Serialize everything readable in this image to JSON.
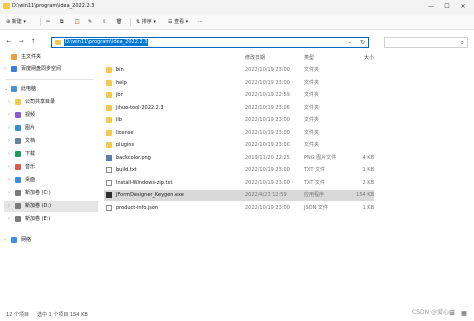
{
  "window": {
    "title": "D:\\win11\\program\\idea_2022.2.3",
    "minimize_glyph": "—",
    "maximize_glyph": "☐",
    "close_glyph": "✕"
  },
  "toolbar": {
    "new_label": "⊕ 新建 ▾",
    "sort_label": "⇅ 排序 ▾",
    "view_label": "☰ 查看 ▾",
    "more_label": "···"
  },
  "nav": {
    "back_glyph": "←",
    "forward_glyph": "→",
    "up_glyph": "↑",
    "address": "D:\\win11\\program\\idea_2022.2.3",
    "chevron_glyph": "⌄",
    "refresh_glyph": "↻",
    "search_glyph": "⌕"
  },
  "sidebar": {
    "items": [
      {
        "label": "主文件夹",
        "icon": "home-icon",
        "color": "#e8a23a"
      },
      {
        "label": "百度网盘同步空间",
        "icon": "cloud-icon",
        "color": "#3b7de0"
      },
      {
        "label": "此电脑",
        "icon": "pc-icon",
        "color": "#4a90d9"
      },
      {
        "label": "公司共享目录",
        "icon": "folder-icon",
        "color": "#f2c94c"
      },
      {
        "label": "视频",
        "icon": "video-icon",
        "color": "#8e5bd6"
      },
      {
        "label": "图片",
        "icon": "pictures-icon",
        "color": "#2f8fd6"
      },
      {
        "label": "文档",
        "icon": "documents-icon",
        "color": "#6b7f99"
      },
      {
        "label": "下载",
        "icon": "download-icon",
        "color": "#1c9a5f"
      },
      {
        "label": "音乐",
        "icon": "music-icon",
        "color": "#e0584a"
      },
      {
        "label": "桌面",
        "icon": "desktop-icon",
        "color": "#3c8fe0"
      },
      {
        "label": "新加卷 (C:)",
        "icon": "drive-icon",
        "color": "#7a7a7a"
      },
      {
        "label": "新加卷 (D:)",
        "icon": "drive-icon",
        "color": "#7a7a7a"
      },
      {
        "label": "新加卷 (E:)",
        "icon": "drive-icon",
        "color": "#7a7a7a"
      },
      {
        "label": "网络",
        "icon": "network-icon",
        "color": "#3c8fe0"
      }
    ],
    "chevron_glyph": "›"
  },
  "columns": {
    "date": "修改日期",
    "type": "类型",
    "size": "大小"
  },
  "files": [
    {
      "name": "bin",
      "date": "2022/10/19 23:00",
      "type": "文件夹",
      "size": "",
      "kind": "folder"
    },
    {
      "name": "help",
      "date": "2022/10/19 23:00",
      "type": "文件夹",
      "size": "",
      "kind": "folder"
    },
    {
      "name": "jbr",
      "date": "2022/10/19 22:59",
      "type": "文件夹",
      "size": "",
      "kind": "folder"
    },
    {
      "name": "jihuo-tool-2022.2.3",
      "date": "2022/10/19 23:06",
      "type": "文件夹",
      "size": "",
      "kind": "folder"
    },
    {
      "name": "lib",
      "date": "2022/10/19 23:00",
      "type": "文件夹",
      "size": "",
      "kind": "folder"
    },
    {
      "name": "license",
      "date": "2022/10/19 23:00",
      "type": "文件夹",
      "size": "",
      "kind": "folder"
    },
    {
      "name": "plugins",
      "date": "2022/10/19 23:00",
      "type": "文件夹",
      "size": "",
      "kind": "folder"
    },
    {
      "name": "backcolor.png",
      "date": "2019/11/20 22:25",
      "type": "PNG 图片文件",
      "size": "4 KB",
      "kind": "png"
    },
    {
      "name": "build.txt",
      "date": "2022/10/19 23:00",
      "type": "TXT 文件",
      "size": "1 KB",
      "kind": "txt"
    },
    {
      "name": "Install-Windows-zip.txt",
      "date": "2022/10/19 23:00",
      "type": "TXT 文件",
      "size": "2 KB",
      "kind": "txt"
    },
    {
      "name": "JFormDesigner_Keygen.exe",
      "date": "2022/4/23 12:59",
      "type": "应用程序",
      "size": "154 KB",
      "kind": "exe",
      "selected": true
    },
    {
      "name": "product-info.json",
      "date": "2022/10/19 23:00",
      "type": "JSON 文件",
      "size": "1 KB",
      "kind": "json"
    }
  ],
  "status": {
    "count": "12 个项目",
    "selection": "选中 1 个项目",
    "size": "154 KB",
    "details_glyph": "☰",
    "tiles_glyph": "▦"
  },
  "watermark": "CSDN @爱心山"
}
